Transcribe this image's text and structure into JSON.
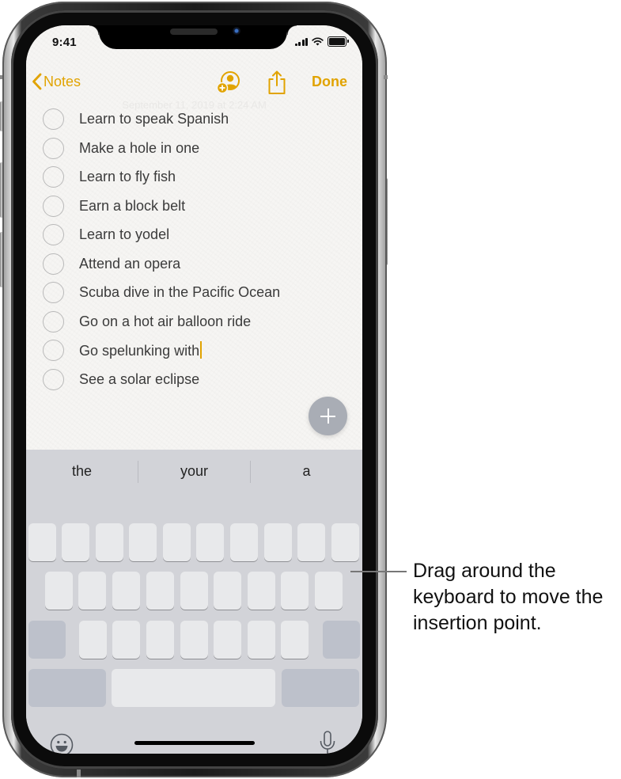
{
  "status_bar": {
    "time": "9:41",
    "icons": [
      "cellular-signal-icon",
      "wifi-icon",
      "battery-icon"
    ]
  },
  "nav": {
    "back_label": "Notes",
    "back_icon": "chevron-left-icon",
    "add_people_icon": "add-person-icon",
    "share_icon": "share-icon",
    "done_label": "Done",
    "accent_color": "#E1A300"
  },
  "note": {
    "date": "September 11, 2019 at 2:24 AM",
    "checklist": [
      {
        "text": "Learn to speak Spanish",
        "checked": false
      },
      {
        "text": "Make a hole in one",
        "checked": false
      },
      {
        "text": "Learn to fly fish",
        "checked": false
      },
      {
        "text": "Earn a block belt",
        "checked": false
      },
      {
        "text": "Learn to yodel",
        "checked": false
      },
      {
        "text": "Attend an opera",
        "checked": false
      },
      {
        "text": "Scuba dive in the Pacific Ocean",
        "checked": false
      },
      {
        "text": "Go on a hot air balloon ride",
        "checked": false
      },
      {
        "text": "Go spelunking with",
        "checked": false,
        "has_insertion_point": true
      },
      {
        "text": "See a solar eclipse",
        "checked": false
      }
    ],
    "add_button_icon": "plus-icon"
  },
  "keyboard": {
    "suggestions": [
      "the",
      "your",
      "a"
    ],
    "mode": "trackpad",
    "emoji_icon": "emoji-icon",
    "dictation_icon": "microphone-icon"
  },
  "callout": {
    "text": "Drag around the keyboard to move the insertion point."
  }
}
